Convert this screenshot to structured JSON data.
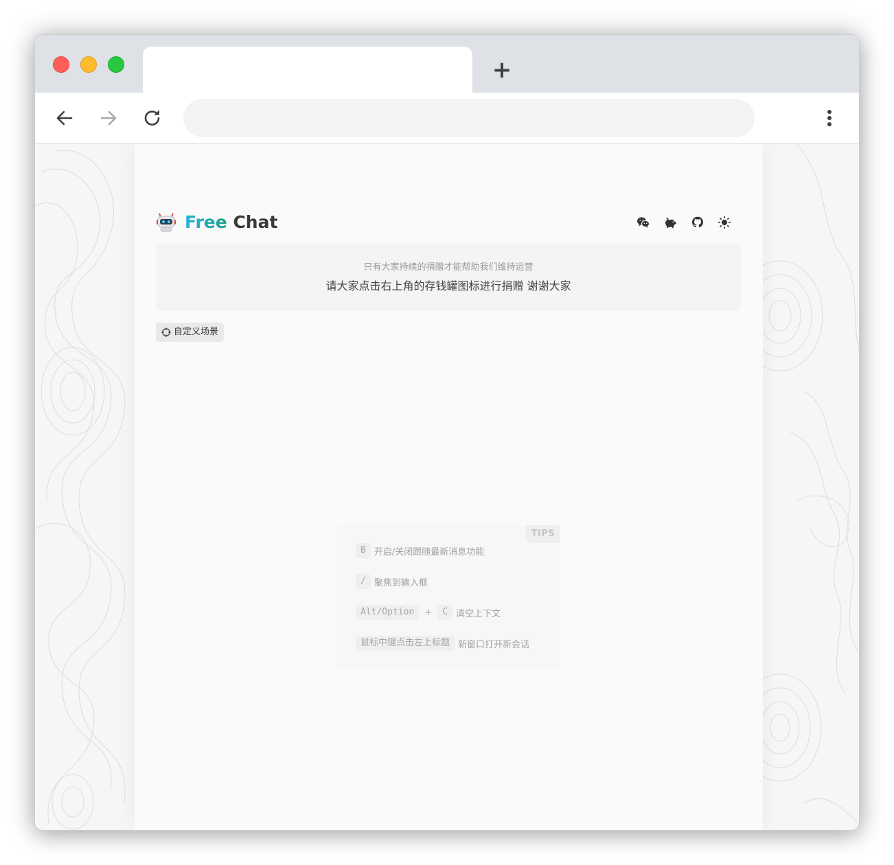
{
  "browser": {
    "new_tab_symbol": "+",
    "tab_title": "",
    "address_value": ""
  },
  "header": {
    "brand_free": "Free",
    "brand_chat": "Chat"
  },
  "notice": {
    "line1": "只有大家持续的捐赠才能帮助我们维持运营",
    "line2": "请大家点击右上角的存钱罐图标进行捐赠 谢谢大家"
  },
  "scene_button": {
    "label": "自定义场景"
  },
  "tips": {
    "badge": "TIPS",
    "items": [
      {
        "keys": [
          "B"
        ],
        "text": "开启/关闭跟随最新消息功能"
      },
      {
        "keys": [
          "/"
        ],
        "text": "聚焦到输入框"
      },
      {
        "keys": [
          "Alt/Option",
          "C"
        ],
        "joiner": "+",
        "text": "清空上下文"
      },
      {
        "keys": [
          "鼠标中键点击左上标题"
        ],
        "text": "新窗口打开新会话"
      }
    ]
  },
  "icons": [
    "wechat-icon",
    "piggy-bank-icon",
    "github-icon",
    "sun-icon"
  ],
  "colors": {
    "brand_gradient_start": "#2ab0d8",
    "brand_gradient_end": "#1ba38a",
    "brand_chat": "#3a3a3a",
    "page_bg": "#fafafa",
    "notice_bg": "#f3f4f4"
  }
}
